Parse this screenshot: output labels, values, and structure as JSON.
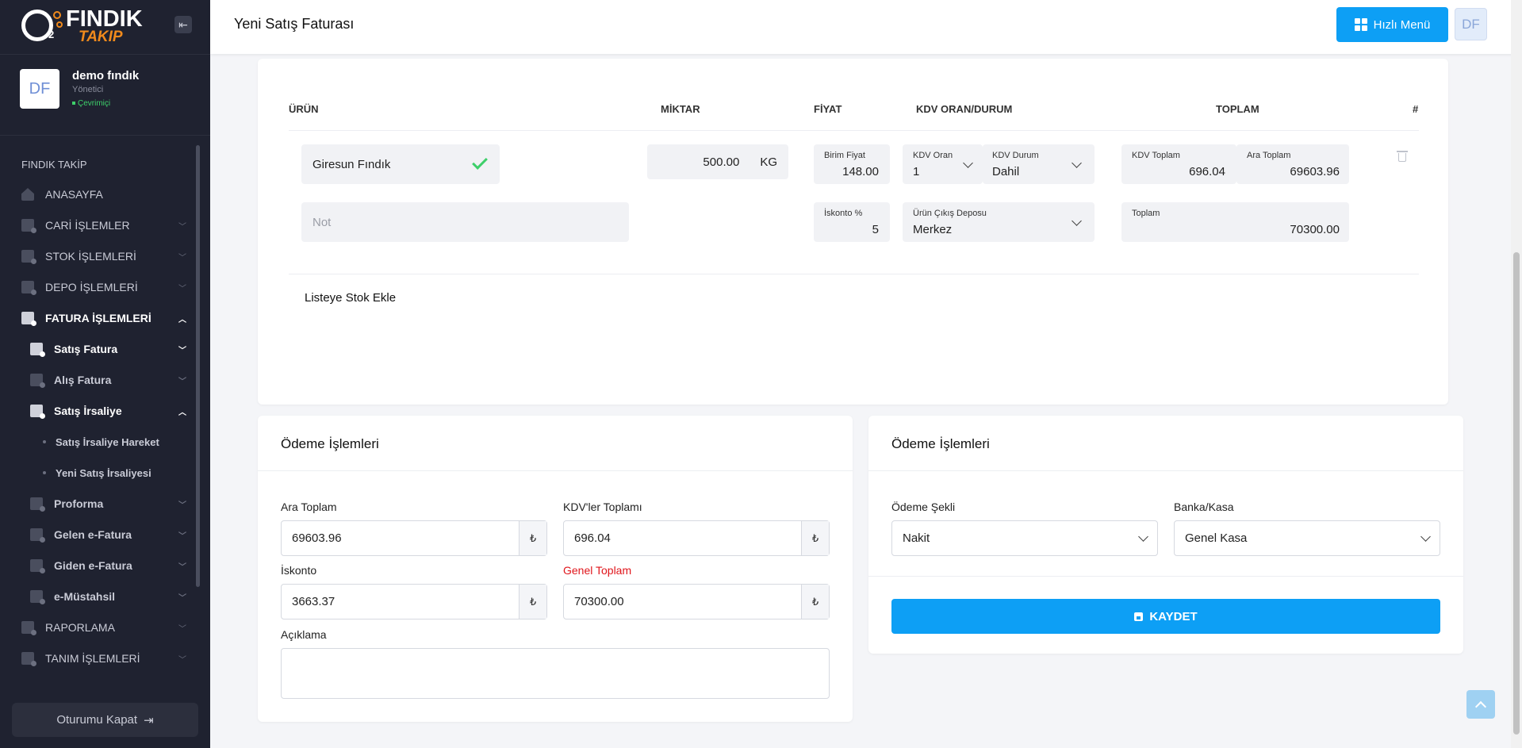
{
  "brand": {
    "logo_word": "FINDIK",
    "logo_sub": "TAKIP",
    "logo_mark": "2"
  },
  "user": {
    "initials": "DF",
    "name": "demo fındık",
    "role": "Yönetici",
    "status": "Çevrimiçi"
  },
  "sidebar": {
    "section": "FINDIK TAKİP",
    "items": [
      {
        "label": "ANASAYFA"
      },
      {
        "label": "CARİ İŞLEMLER"
      },
      {
        "label": "STOK İŞLEMLERİ"
      },
      {
        "label": "DEPO İŞLEMLERİ"
      },
      {
        "label": "FATURA İŞLEMLERİ"
      },
      {
        "label": "Satış Fatura"
      },
      {
        "label": "Alış Fatura"
      },
      {
        "label": "Satış İrsaliye"
      },
      {
        "label": "Satış İrsaliye Hareket"
      },
      {
        "label": "Yeni Satış İrsaliyesi"
      },
      {
        "label": "Proforma"
      },
      {
        "label": "Gelen e-Fatura"
      },
      {
        "label": "Giden e-Fatura"
      },
      {
        "label": "e-Müstahsil"
      },
      {
        "label": "RAPORLAMA"
      },
      {
        "label": "TANIM İŞLEMLERİ"
      }
    ],
    "logout": "Oturumu Kapat"
  },
  "header": {
    "title": "Yeni Satış Faturası",
    "quick_menu": "Hızlı Menü",
    "avatar_initials": "DF"
  },
  "items_table": {
    "columns": [
      "ÜRÜN",
      "MİKTAR",
      "FİYAT",
      "KDV ORAN/DURUM",
      "TOPLAM",
      "#"
    ],
    "row": {
      "product": "Giresun Fındık",
      "quantity": "500.00",
      "unit": "KG",
      "unit_price_label": "Birim Fiyat",
      "unit_price": "148.00",
      "vat_rate_label": "KDV Oran",
      "vat_rate": "1",
      "vat_status_label": "KDV Durum",
      "vat_status": "Dahil",
      "vat_total_label": "KDV Toplam",
      "vat_total": "696.04",
      "subtotal_label": "Ara Toplam",
      "subtotal": "69603.96",
      "note_placeholder": "Not",
      "discount_label": "İskonto %",
      "discount": "5",
      "warehouse_label": "Ürün Çıkış Deposu",
      "warehouse": "Merkez",
      "total_label": "Toplam",
      "total": "70300.00"
    },
    "add_stock": "Listeye Stok Ekle"
  },
  "payment_left": {
    "title": "Ödeme İşlemleri",
    "subtotal_label": "Ara Toplam",
    "subtotal": "69603.96",
    "vat_total_label": "KDV'ler Toplamı",
    "vat_total": "696.04",
    "discount_label": "İskonto",
    "discount": "3663.37",
    "grand_total_label": "Genel Toplam",
    "grand_total": "70300.00",
    "currency": "₺",
    "description_label": "Açıklama",
    "description": ""
  },
  "payment_right": {
    "title": "Ödeme İşlemleri",
    "method_label": "Ödeme Şekli",
    "method": "Nakit",
    "account_label": "Banka/Kasa",
    "account": "Genel Kasa",
    "save": "KAYDET"
  },
  "colors": {
    "primary": "#0d9ff5",
    "sidebar": "#1f2230",
    "accent": "#f08a1c",
    "success": "#3ecf6a",
    "danger": "#e0151b"
  }
}
